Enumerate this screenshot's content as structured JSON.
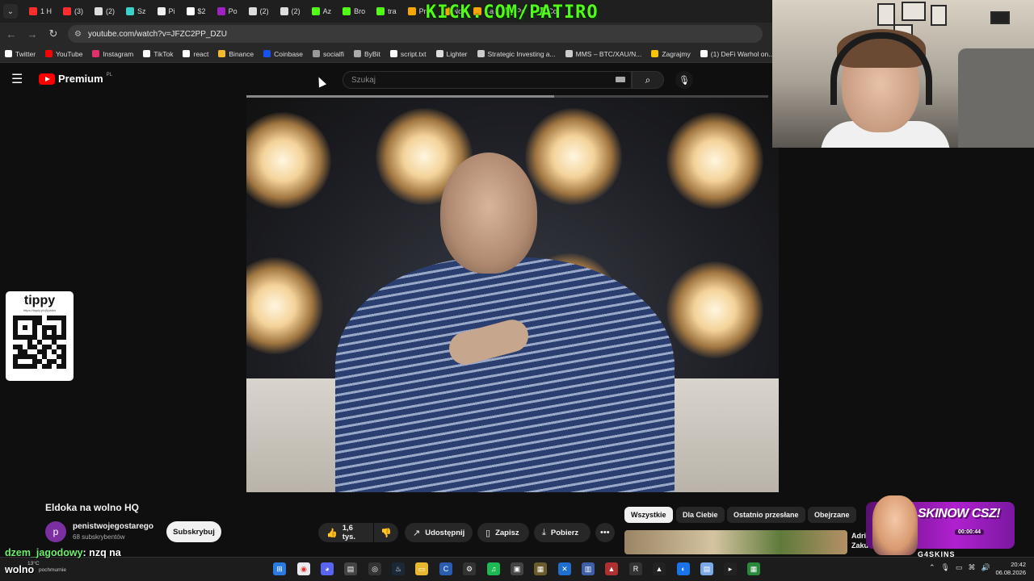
{
  "browser": {
    "tabs": [
      {
        "label": "1 H",
        "color": "#ff2d2d"
      },
      {
        "label": "(3)",
        "color": "#ff2d2d"
      },
      {
        "label": "(2)",
        "color": "#dddddd"
      },
      {
        "label": "Sz",
        "color": "#3ad1c8"
      },
      {
        "label": "Pi",
        "color": "#eeeeee"
      },
      {
        "label": "$2",
        "color": "#ffffff"
      },
      {
        "label": "Po",
        "color": "#a020c0"
      },
      {
        "label": "(2)",
        "color": "#dddddd"
      },
      {
        "label": "(2)",
        "color": "#dddddd"
      },
      {
        "label": "Az",
        "color": "#53fc18"
      },
      {
        "label": "Bro",
        "color": "#53fc18"
      },
      {
        "label": "tra",
        "color": "#53fc18"
      },
      {
        "label": "Pro",
        "color": "#f7a600"
      },
      {
        "label": "No",
        "color": "#f7a600"
      },
      {
        "label": "Ba",
        "color": "#f7a600"
      },
      {
        "label": "Pa",
        "color": "#53fc18"
      },
      {
        "label": "Co",
        "color": "#53fc18"
      }
    ],
    "kick_overlay": "KICK.COM/PATIRO",
    "url": "youtube.com/watch?v=JFZC2PP_DZU",
    "bookmarks": [
      {
        "label": "Twitter",
        "color": "#ffffff"
      },
      {
        "label": "YouTube",
        "color": "#ff0000"
      },
      {
        "label": "Instagram",
        "color": "#e1306c"
      },
      {
        "label": "TikTok",
        "color": "#ffffff"
      },
      {
        "label": "react",
        "color": "#ffffff"
      },
      {
        "label": "Binance",
        "color": "#f3ba2f"
      },
      {
        "label": "Coinbase",
        "color": "#1652f0"
      },
      {
        "label": "socialfi",
        "color": "#999999"
      },
      {
        "label": "ByBit",
        "color": "#aaaaaa"
      },
      {
        "label": "script.txt",
        "color": "#ffffff"
      },
      {
        "label": "Lighter",
        "color": "#dddddd"
      },
      {
        "label": "Strategic Investing a...",
        "color": "#cccccc"
      },
      {
        "label": "MMS – BTC/XAU/N...",
        "color": "#cccccc"
      },
      {
        "label": "Zagrajmy",
        "color": "#f7c600"
      },
      {
        "label": "(1) DeFi Warhol on...",
        "color": "#ffffff"
      }
    ]
  },
  "youtube": {
    "logo_text": "Premium",
    "logo_region": "PL",
    "search_placeholder": "Szukaj",
    "video_progress": 0.59,
    "video": {
      "title": "Eldoka na wolno HQ",
      "channel_initial": "p",
      "channel": "penistwojegostarego",
      "subscribers": "68 subskrybentów",
      "subscribe_label": "Subskrybuj",
      "likes": "1,6 tys.",
      "share_label": "Udostępnij",
      "save_label": "Zapisz",
      "download_label": "Pobierz"
    },
    "chips": [
      "Wszystkie",
      "Dla Ciebie",
      "Ostatnio przesłane",
      "Obejrzane"
    ],
    "recommendation_title_1": "Adri",
    "recommendation_title_2": "Zaku"
  },
  "overlays": {
    "tippy_logo": "tippy",
    "tippy_url": "https://tipply.pl/@patiro",
    "ad_text": "SKINOW CSZ!",
    "ad_timer": "00:00:44",
    "ad_brand": "G4SKINS",
    "chat_user": "dzem_jagodowy",
    "chat_message": ": nzq na",
    "chat_message_2": "wolno"
  },
  "taskbar": {
    "weather_temp": "13°C",
    "weather_desc": "pochmurnie",
    "time": "20:42",
    "date": "06.08.2026"
  },
  "colors": {
    "kick_green": "#53fc18",
    "youtube_red": "#ff0000",
    "background": "#0f0f0f"
  }
}
